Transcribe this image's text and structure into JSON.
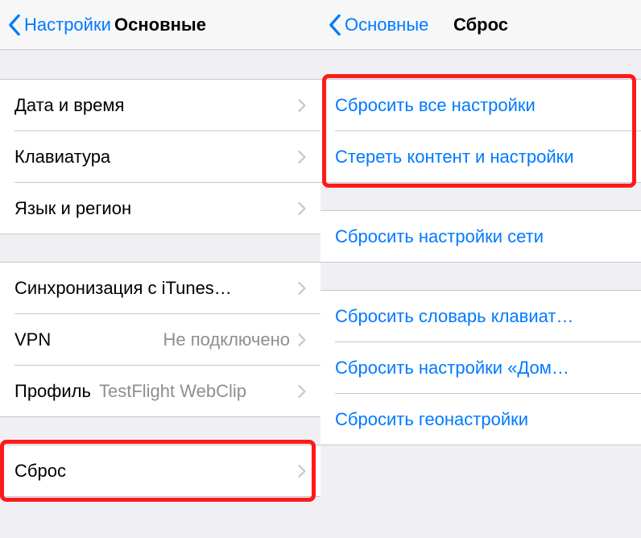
{
  "left": {
    "back_label": "Настройки",
    "title": "Основные",
    "group1": {
      "date_time": "Дата и время",
      "keyboard": "Клавиатура",
      "lang_region": "Язык и регион"
    },
    "group2": {
      "itunes_sync": "Синхронизация с iTunes…",
      "vpn_label": "VPN",
      "vpn_value": "Не подключено",
      "profile_label": "Профиль",
      "profile_value": "TestFlight WebClip"
    },
    "group3": {
      "reset": "Сброс"
    }
  },
  "right": {
    "back_label": "Основные",
    "title": "Сброс",
    "group1": {
      "reset_all": "Сбросить все настройки",
      "erase_all": "Стереть контент и настройки"
    },
    "group2": {
      "reset_network": "Сбросить настройки сети"
    },
    "group3": {
      "reset_keyboard": "Сбросить словарь клавиат…",
      "reset_home": "Сбросить настройки «Дом…",
      "reset_location": "Сбросить геонастройки"
    }
  }
}
